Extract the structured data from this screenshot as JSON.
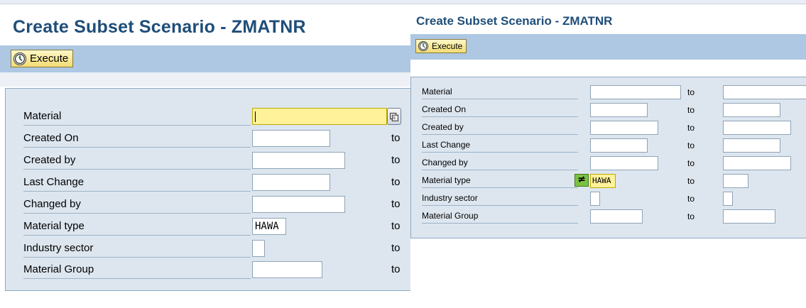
{
  "left": {
    "title": "Create Subset Scenario - ZMATNR",
    "toolbar": {
      "execute_label": "Execute"
    },
    "fields": [
      {
        "label": "Material",
        "value": "",
        "to": ""
      },
      {
        "label": "Created On",
        "value": "",
        "to": "to"
      },
      {
        "label": "Created by",
        "value": "",
        "to": "to"
      },
      {
        "label": "Last Change",
        "value": "",
        "to": "to"
      },
      {
        "label": "Changed by",
        "value": "",
        "to": "to"
      },
      {
        "label": "Material type",
        "value": "HAWA",
        "to": "to"
      },
      {
        "label": "Industry sector",
        "value": "",
        "to": "to"
      },
      {
        "label": "Material Group",
        "value": "",
        "to": "to"
      }
    ]
  },
  "right": {
    "title": "Create Subset Scenario - ZMATNR",
    "toolbar": {
      "execute_label": "Execute"
    },
    "fields": [
      {
        "label": "Material",
        "value": "",
        "to": "to"
      },
      {
        "label": "Created On",
        "value": "",
        "to": "to"
      },
      {
        "label": "Created by",
        "value": "",
        "to": "to"
      },
      {
        "label": "Last Change",
        "value": "",
        "to": "to"
      },
      {
        "label": "Changed by",
        "value": "",
        "to": "to"
      },
      {
        "label": "Material type",
        "value": "HAWA",
        "to": "to",
        "operator": "≠"
      },
      {
        "label": "Industry sector",
        "value": "",
        "to": "to"
      },
      {
        "label": "Material Group",
        "value": "",
        "to": "to"
      }
    ]
  },
  "colors": {
    "title": "#1f4e79",
    "toolbar": "#aec8e3",
    "form_background": "#dde6ef",
    "active_field": "#fff29a",
    "operator_icon": "#7cc242"
  },
  "icons": [
    "execute-clock-icon",
    "multiple-selection-icon",
    "not-equal-operator-icon"
  ]
}
